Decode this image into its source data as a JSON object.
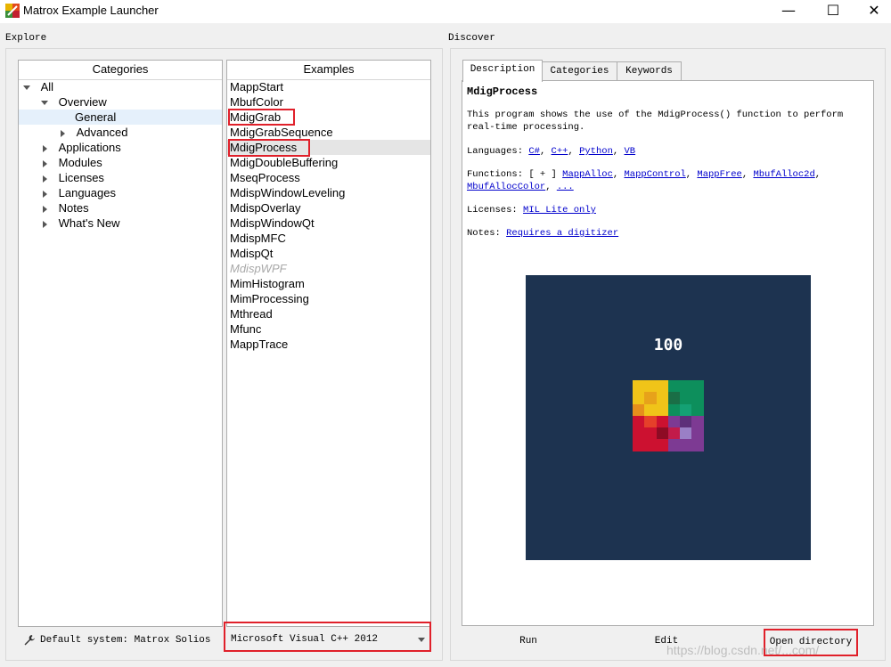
{
  "window": {
    "title": "Matrox Example Launcher",
    "min": "—",
    "max": "☐",
    "close": "✕"
  },
  "explore": {
    "label": "Explore"
  },
  "discover": {
    "label": "Discover"
  },
  "categories": {
    "header": "Categories",
    "items": [
      {
        "label": "All"
      },
      {
        "label": "Overview"
      },
      {
        "label": "General"
      },
      {
        "label": "Advanced"
      },
      {
        "label": "Applications"
      },
      {
        "label": "Modules"
      },
      {
        "label": "Licenses"
      },
      {
        "label": "Languages"
      },
      {
        "label": "Notes"
      },
      {
        "label": "What's New"
      }
    ]
  },
  "examples": {
    "header": "Examples",
    "items": [
      {
        "label": "MappStart"
      },
      {
        "label": "MbufColor"
      },
      {
        "label": "MdigGrab"
      },
      {
        "label": "MdigGrabSequence"
      },
      {
        "label": "MdigProcess"
      },
      {
        "label": "MdigDoubleBuffering"
      },
      {
        "label": "MseqProcess"
      },
      {
        "label": "MdispWindowLeveling"
      },
      {
        "label": "MdispOverlay"
      },
      {
        "label": "MdispWindowQt"
      },
      {
        "label": "MdispMFC"
      },
      {
        "label": "MdispQt"
      },
      {
        "label": "MdispWPF"
      },
      {
        "label": "MimHistogram"
      },
      {
        "label": "MimProcessing"
      },
      {
        "label": "Mthread"
      },
      {
        "label": "Mfunc"
      },
      {
        "label": "MappTrace"
      }
    ]
  },
  "status": {
    "default_system": "Default system: Matrox Solios"
  },
  "compiler": {
    "selected": "Microsoft Visual C++ 2012"
  },
  "tabs": [
    {
      "label": "Description"
    },
    {
      "label": "Categories"
    },
    {
      "label": "Keywords"
    }
  ],
  "description": {
    "title": "MdigProcess",
    "body": "This program shows the use of the MdigProcess() function to perform real-time processing.",
    "languages_label": "Languages:",
    "languages": [
      "C#",
      "C++",
      "Python",
      "VB"
    ],
    "functions_label": "Functions:",
    "functions_toggle": "[ + ]",
    "functions": [
      "MappAlloc",
      "MappControl",
      "MappFree",
      "MbufAlloc2d",
      "MbufAllocColor",
      "..."
    ],
    "licenses_label": "Licenses:",
    "licenses_link": "MIL Lite only",
    "notes_label": "Notes:",
    "notes_link": "Requires a digitizer",
    "preview_number": "100",
    "preview_bg": "#1d3350"
  },
  "buttons": {
    "run": "Run",
    "edit": "Edit",
    "open_directory": "Open directory"
  },
  "watermark": "https://blog.csdn.net/...com/"
}
